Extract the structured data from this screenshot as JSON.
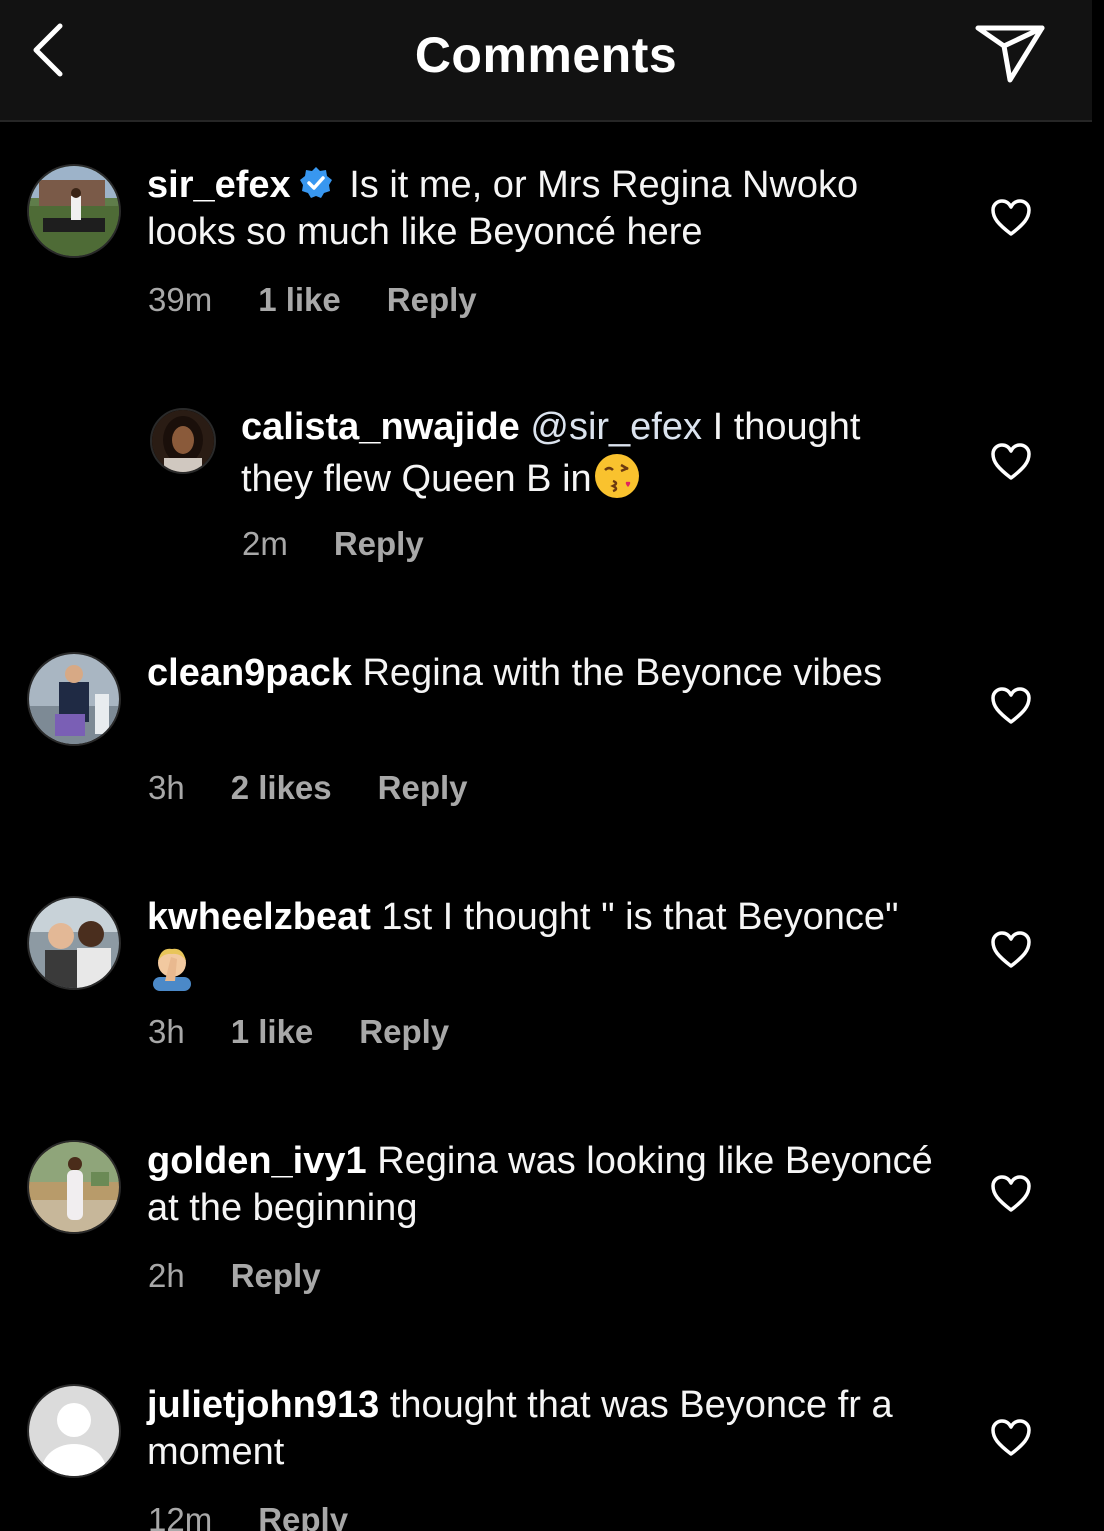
{
  "header": {
    "title": "Comments",
    "back_icon": "chevron-left-icon",
    "send_icon": "paper-plane-icon"
  },
  "colors": {
    "background": "#000000",
    "header_bg": "#121212",
    "meta_text": "#a8a8a8",
    "verified": "#3897f0"
  },
  "comments": [
    {
      "username": "sir_efex",
      "verified": true,
      "text": " Is it me, or Mrs Regina Nwoko looks so much like Beyoncé here",
      "time": "39m",
      "likes": "1 like",
      "reply": "Reply"
    },
    {
      "username": "calista_nwajide",
      "mention": " @sir_efex",
      "text": " I thought they flew Queen B in",
      "emoji": "kissing-face-emoji",
      "time": "2m",
      "reply": "Reply",
      "is_reply": true
    },
    {
      "username": "clean9pack",
      "text": " Regina with the Beyonce vibes",
      "time": "3h",
      "likes": "2 likes",
      "reply": "Reply"
    },
    {
      "username": "kwheelzbeat",
      "text": " 1st I thought \" is that Beyonce\"",
      "emoji": "facepalm-emoji",
      "time": "3h",
      "likes": "1 like",
      "reply": "Reply"
    },
    {
      "username": "golden_ivy1",
      "text": " Regina was looking like Beyoncé at the beginning",
      "time": "2h",
      "reply": "Reply"
    },
    {
      "username": "julietjohn913",
      "text": " thought that was Beyonce fr a moment",
      "time": "12m",
      "reply": "Reply"
    }
  ]
}
